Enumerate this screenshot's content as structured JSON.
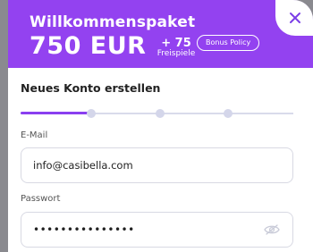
{
  "banner": {
    "title": "Willkommenspaket",
    "amount": "750 EUR",
    "extra_plus": "+ 75",
    "extra_label": "Freispiele",
    "bonus_button_label": "Bonus Policy"
  },
  "form": {
    "title": "Neues Konto erstellen",
    "steps": {
      "current": 1,
      "total": 4
    },
    "email_label": "E-Mail",
    "email_value": "info@casibella.com",
    "password_label": "Passwort",
    "password_value": "•••••••••••••••"
  },
  "icons": {
    "close": "close-icon",
    "password_visibility": "eye-off-icon"
  },
  "colors": {
    "brand": "#9342f0",
    "progress": "#8a3ff0",
    "inactive_step": "#d4d6ea"
  }
}
